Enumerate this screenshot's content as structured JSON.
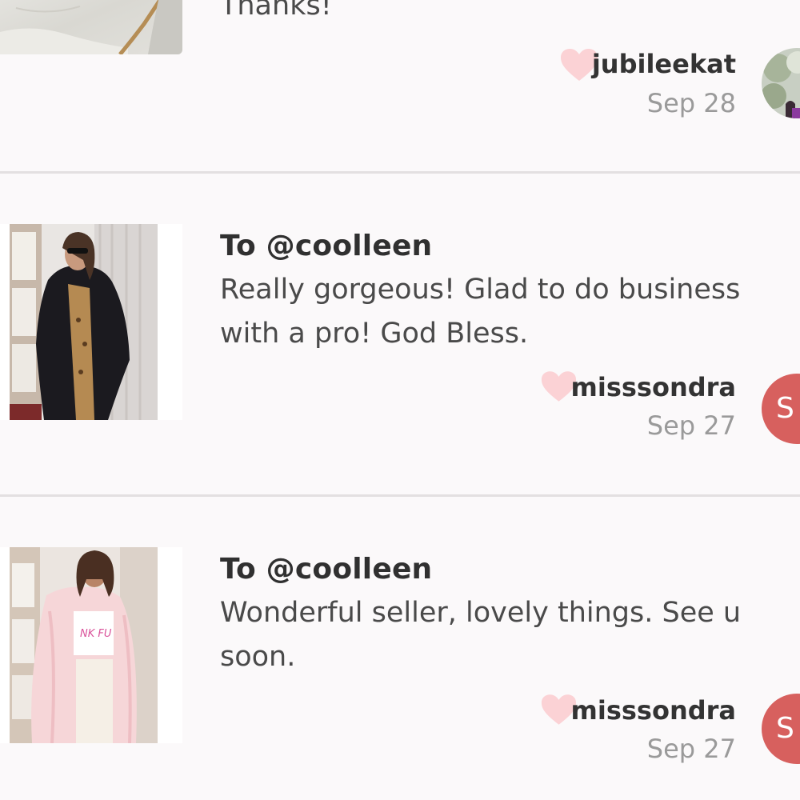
{
  "reviews": [
    {
      "message": "Thanks!",
      "user": "jubileekat",
      "date": "Sep 28",
      "avatar_icon": "photo-avatar"
    },
    {
      "to": "To @coolleen",
      "message": "Really gorgeous! Glad to do business with a pro! God Bless.",
      "user": "misssondra",
      "date": "Sep 27",
      "avatar_initial": "S",
      "thumb_icon": "black-faux-fur-coat-photo"
    },
    {
      "to": "To @coolleen",
      "message": "Wonderful seller, lovely things. See u soon.",
      "user": "misssondra",
      "date": "Sep 27",
      "avatar_initial": "S",
      "thumb_icon": "pink-faux-fur-coat-photo",
      "thumb_print": "NK FU"
    }
  ],
  "colors": {
    "heart": "#fbd2d5",
    "avatar": "#d7605e",
    "background": "#fbf9fa",
    "divider": "#e3e0e1"
  }
}
